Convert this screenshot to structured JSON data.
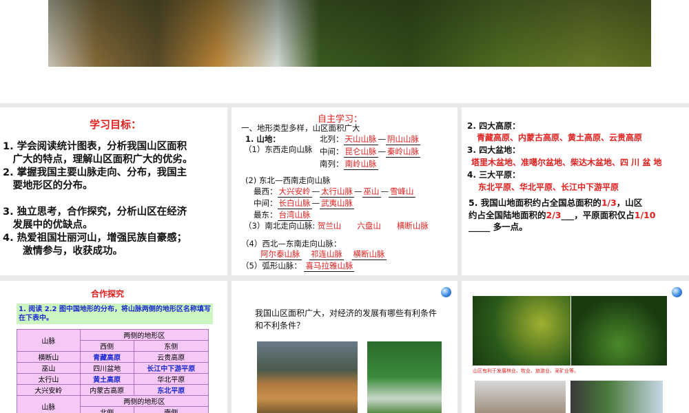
{
  "slide1": {
    "title": "学习目标：",
    "items": [
      "1. 学会阅读统计图表，分析我国山区面积",
      "　广大的特点，理解山区面积广大的优劣。",
      "2. 掌握我国主要山脉走向、分布，我国主",
      "　要地形区的分布。",
      "3. 独立思考，合作探究，分析山区在经济",
      "　发展中的优缺点。",
      "4. 热爱祖国壮丽河山，增强民族自豪感；",
      "　　激情参与，收获成功。"
    ]
  },
  "slide2": {
    "title": "自主学习：",
    "heading": "一、地形类型多样，山区面积广大",
    "l1": "1. 山地：",
    "l2": "（1）东西走向山脉",
    "north": "北列：",
    "north_a": "天山山脉",
    "north_b": "阴山山脉",
    "mid": "中间：",
    "mid_a": "昆仑山脉",
    "mid_b": "秦岭山脉",
    "south": "南列：",
    "south_a": "南岭山脉",
    "ne": "(2) 东北—西南走向山脉",
    "west": "最西：",
    "west_vals": [
      "大兴安岭",
      "太行山脉",
      "巫山",
      "雪峰山"
    ],
    "center": "中间：",
    "center_vals": [
      "长白山脉",
      "武夷山脉"
    ],
    "east": "最东：",
    "east_val": "台湾山脉",
    "ns": "（3）南北走向山脉:",
    "ns_vals": [
      "贺兰山",
      "六盘山",
      "横断山脉"
    ],
    "nw": "（4）西北—东南走向山脉：",
    "nw_vals": [
      "阿尔泰山脉",
      "祁连山脉",
      "横断山脉"
    ],
    "arc": "（5）弧形山脉：",
    "arc_val": "喜马拉雅山脉",
    "dash": "—"
  },
  "slide3": {
    "q2": "2. 四大高原：",
    "a2": "青藏高原、内蒙古高原、黄土高原、云贵高原",
    "q3": "3. 四大盆地：",
    "a3": "塔里木盆地、准噶尔盆地、柴达木盆地、四 川 盆 地",
    "q4": "4. 三大平原：",
    "a4": "东北平原、华北平原、长江中下游平原",
    "q5a": "5. 我国山地面积约占全国总面积的",
    "v1": "1/3",
    "q5b": "，山区",
    "q5c": "约占全国陆地面积的",
    "v2": "2/3",
    "q5d": "，平原面积仅占",
    "v3": "1/10",
    "q5e": "多一点。"
  },
  "slide4": {
    "title": "合作探究",
    "task": "1. 阅读 2.2 图中国地形的分布，将山脉两侧的地形区名称填写在下表中。",
    "h_mountain": "山脉",
    "h_sides": "两侧的地形区",
    "h_west": "西侧",
    "h_east": "东侧",
    "rows": [
      [
        "横断山",
        "青藏高原",
        "云贵高原"
      ],
      [
        "巫山",
        "四川盆地",
        "长江中下游平原"
      ],
      [
        "太行山",
        "黄土高原",
        "华北平原"
      ],
      [
        "大兴安岭",
        "内蒙古高原",
        "东北平原"
      ]
    ],
    "h_north": "北侧",
    "h_south": "南侧"
  },
  "slide5": {
    "question": "我国山区面积广大，对经济的发展有哪些有利条件和不利条件？"
  },
  "slide6": {
    "caption": "山区有利于发展林业、牧业、旅游业、采矿业等。"
  }
}
